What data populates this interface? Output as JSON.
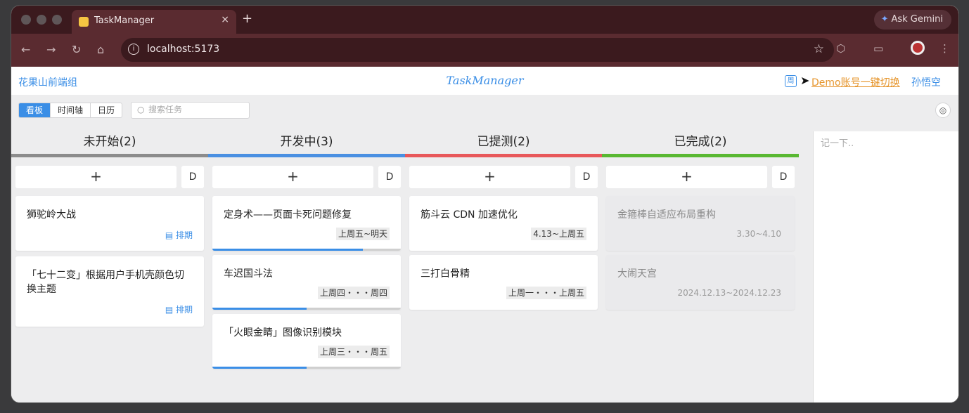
{
  "browser": {
    "tab_title": "TaskManager",
    "tab_close": "×",
    "new_tab": "+",
    "gemini_label": "Ask Gemini",
    "url": "localhost:5173"
  },
  "header": {
    "team": "花果山前端组",
    "logo": "TaskManager",
    "week_icon": "周",
    "demo_link": "Demo账号一键切换",
    "user": "孙悟空"
  },
  "controls": {
    "views": [
      "看板",
      "时间轴",
      "日历"
    ],
    "active_view": "看板",
    "search_placeholder": "搜索任务"
  },
  "colors": {
    "primary": "#3a8ee6",
    "todo": "#8c8c8c",
    "doing": "#4a90e2",
    "testing": "#e8585a",
    "done": "#59b832"
  },
  "columns": [
    {
      "title": "未开始(2)",
      "color": "#8c8c8c",
      "add": "+",
      "d": "D",
      "cards": [
        {
          "title": "狮驼岭大战",
          "schedule": "排期"
        },
        {
          "title": "「七十二变」根据用户手机壳颜色切换主题",
          "schedule": "排期"
        }
      ]
    },
    {
      "title": "开发中(3)",
      "color": "#4a90e2",
      "add": "+",
      "d": "D",
      "cards": [
        {
          "title": "定身术——页面卡死问题修复",
          "date": "上周五~明天",
          "progress": 0.8
        },
        {
          "title": "车迟国斗法",
          "date": "上周四・・・周四",
          "progress": 0.5
        },
        {
          "title": "「火眼金睛」图像识别模块",
          "date": "上周三・・・周五",
          "progress": 0.5
        }
      ]
    },
    {
      "title": "已提测(2)",
      "color": "#e8585a",
      "add": "+",
      "d": "D",
      "cards": [
        {
          "title": "筋斗云 CDN 加速优化",
          "date": "4.13~上周五"
        },
        {
          "title": "三打白骨精",
          "date": "上周一・・・上周五"
        }
      ]
    },
    {
      "title": "已完成(2)",
      "color": "#59b832",
      "add": "+",
      "d": "D",
      "cards": [
        {
          "title": "金箍棒自适应布局重构",
          "date": "3.30~4.10"
        },
        {
          "title": "大闹天宫",
          "date": "2024.12.13~2024.12.23"
        }
      ]
    }
  ],
  "memo": {
    "placeholder": "记一下.."
  }
}
